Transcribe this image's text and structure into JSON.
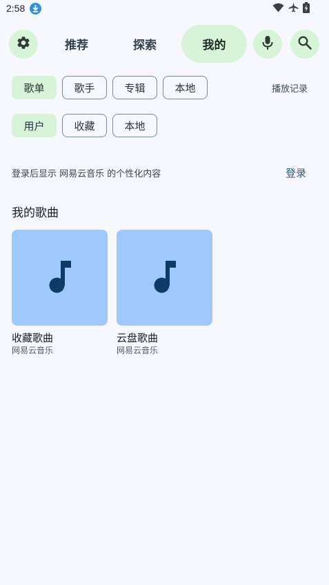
{
  "status_bar": {
    "time": "2:58",
    "icons": [
      "download-icon",
      "wifi-icon",
      "airplane-icon",
      "battery-icon"
    ]
  },
  "topnav": {
    "settings_icon": "gear-icon",
    "tabs": [
      {
        "label": "推荐",
        "active": false
      },
      {
        "label": "探索",
        "active": false
      },
      {
        "label": "我的",
        "active": true
      }
    ],
    "mic_icon": "mic-icon",
    "search_icon": "search-icon"
  },
  "chips_row1": [
    {
      "label": "歌单",
      "selected": true
    },
    {
      "label": "歌手",
      "selected": false
    },
    {
      "label": "专辑",
      "selected": false
    },
    {
      "label": "本地",
      "selected": false
    }
  ],
  "history_label": "播放记录",
  "chips_row2": [
    {
      "label": "用户",
      "selected": true
    },
    {
      "label": "收藏",
      "selected": false
    },
    {
      "label": "本地",
      "selected": false
    }
  ],
  "login_notice": {
    "text": "登录后显示 网易云音乐 的个性化内容",
    "action": "登录"
  },
  "my_songs": {
    "title": "我的歌曲",
    "cards": [
      {
        "title": "收藏歌曲",
        "subtitle": "网易云音乐",
        "icon": "music-note-icon"
      },
      {
        "title": "云盘歌曲",
        "subtitle": "网易云音乐",
        "icon": "music-note-icon"
      }
    ]
  },
  "colors": {
    "background": "#f7f8fe",
    "accent_chip": "#d7f3d8",
    "card_art": "#9ec8ff",
    "note": "#0c3b66",
    "link": "#2e5a85"
  }
}
